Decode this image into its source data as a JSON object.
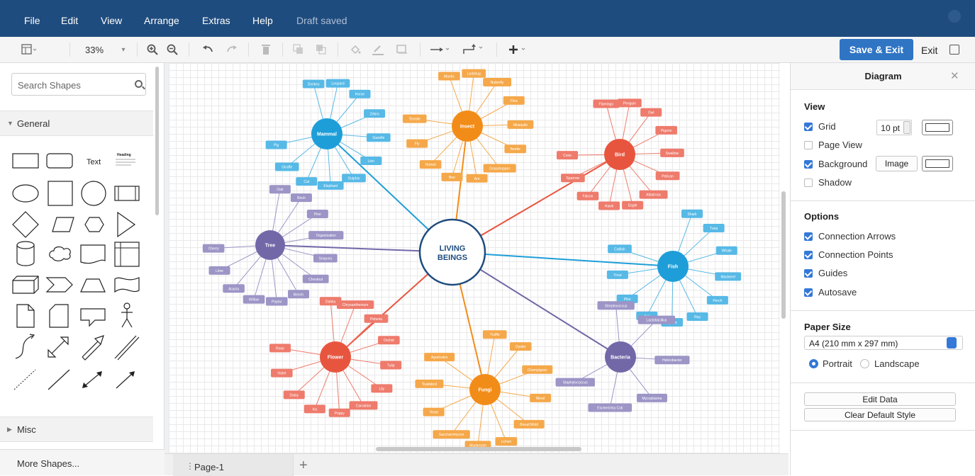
{
  "menu": {
    "items": [
      "File",
      "Edit",
      "View",
      "Arrange",
      "Extras",
      "Help"
    ],
    "status": "Draft saved"
  },
  "toolbar": {
    "zoom": "33%",
    "save_exit": "Save & Exit",
    "exit": "Exit"
  },
  "sidebar": {
    "search_placeholder": "Search Shapes",
    "general": "General",
    "text_shape": "Text",
    "heading_shape": "Heading",
    "misc": "Misc",
    "more_shapes": "More Shapes..."
  },
  "pages": {
    "current": "Page-1"
  },
  "panel": {
    "title": "Diagram",
    "view_heading": "View",
    "grid_label": "Grid",
    "grid_checked": true,
    "grid_size": "10 pt",
    "page_view_label": "Page View",
    "page_view_checked": false,
    "background_label": "Background",
    "background_checked": true,
    "image_button": "Image",
    "shadow_label": "Shadow",
    "shadow_checked": false,
    "options_heading": "Options",
    "options": [
      {
        "label": "Connection Arrows",
        "checked": true
      },
      {
        "label": "Connection Points",
        "checked": true
      },
      {
        "label": "Guides",
        "checked": true
      },
      {
        "label": "Autosave",
        "checked": true
      }
    ],
    "paper_heading": "Paper Size",
    "paper_size": "A4 (210 mm x 297 mm)",
    "orientation_portrait": "Portrait",
    "orientation_landscape": "Landscape",
    "orientation_selected": "Portrait",
    "edit_data": "Edit Data",
    "clear_style": "Clear Default Style"
  },
  "diagram": {
    "center": "LIVING BEINGS",
    "center_line1": "LIVING",
    "center_line2": "BEINGS",
    "colors": {
      "mammal": "#1e9ed8",
      "insect": "#f28c18",
      "bird": "#e8553f",
      "tree": "#7268a8",
      "fish": "#1e9ed8",
      "flower": "#e8553f",
      "fungi": "#f28c18",
      "bacteria": "#7268a8",
      "mammal_leaf": "#57b9e6",
      "insect_leaf": "#f5a84a",
      "bird_leaf": "#ee7b6c",
      "tree_leaf": "#9c95c6",
      "fish_leaf": "#57b9e6",
      "flower_leaf": "#ee7b6c",
      "fungi_leaf": "#f5a84a",
      "bacteria_leaf": "#9c95c6"
    },
    "branches": {
      "mammal": {
        "label": "Mammal",
        "leaves": [
          "Donkey",
          "Leopard",
          "Horse",
          "Zebra",
          "Gazelle",
          "Lion",
          "Dolphin",
          "Elephant",
          "Cat",
          "Giraffe",
          "Pig"
        ]
      },
      "insect": {
        "label": "Insect",
        "leaves": [
          "Mantis",
          "Ladybug",
          "Butterfly",
          "Flea",
          "Mosquito",
          "Beetle",
          "Grasshopper",
          "Ant",
          "Bee",
          "Hornet",
          "Fly",
          "Termite"
        ]
      },
      "bird": {
        "label": "Bird",
        "leaves": [
          "Flamingo",
          "Penguin",
          "Owl",
          "Pigeon",
          "Swallow",
          "Pelican",
          "Albatross",
          "Eagle",
          "Hawk",
          "Falcon",
          "Sparrow",
          "Crow"
        ]
      },
      "tree": {
        "label": "Tree",
        "leaves": [
          "Oak",
          "Birch",
          "Pine",
          "Organization",
          "Sequoia",
          "Chestnut",
          "Beech",
          "Poplar",
          "Willow",
          "Acacia",
          "Lime",
          "Cherry"
        ]
      },
      "fish": {
        "label": "Fish",
        "leaves": [
          "Shark",
          "Tuna",
          "Whale",
          "Mackerel",
          "Perch",
          "Ray",
          "Oyster",
          "Eel",
          "Pike",
          "Trout",
          "Catfish"
        ]
      },
      "flower": {
        "label": "Flower",
        "leaves": [
          "Dahlia",
          "Chrysanthemum",
          "Petunia",
          "Orchid",
          "Tulip",
          "Lily",
          "Carnation",
          "Poppy",
          "Iris",
          "Daisy",
          "Violet",
          "Rose"
        ]
      },
      "fungi": {
        "label": "Fungi",
        "leaves": [
          "Truffle",
          "Oyster",
          "Champignon",
          "Morel",
          "Bread Mold",
          "Lichen",
          "Mushroom",
          "Saccharomyces",
          "Yeast",
          "Toadstool",
          "Agaricales"
        ]
      },
      "bacteria": {
        "label": "Bacteria",
        "leaves": [
          "Streptococcus",
          "Lactobacillus",
          "Helicobacter",
          "Mycoplasma",
          "Escherichia Coli",
          "Staphylococcus"
        ]
      }
    }
  }
}
